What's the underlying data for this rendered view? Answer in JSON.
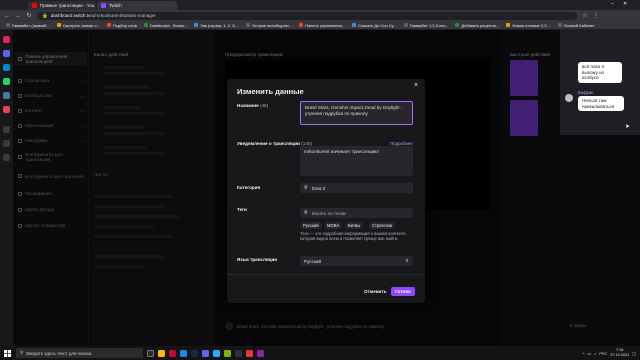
{
  "browser": {
    "tabs": [
      {
        "title": "Прямые трансляции - You",
        "color": "#ff0000",
        "active": false
      },
      {
        "title": "Twitch",
        "color": "#9147ff",
        "active": true
      }
    ],
    "url_domain": "dashboard.twitch.tv",
    "url_path": "/u/mrkonkurent/stream-manager",
    "bookmarks": [
      {
        "label": "Гаммабит (гаммаб...",
        "color": "#5f6368"
      },
      {
        "label": "Смотреть аниме о...",
        "color": "#f29900"
      },
      {
        "label": "Подбор слов",
        "color": "#ea4335"
      },
      {
        "label": "Dashboard - Books...",
        "color": "#1e8e3e"
      },
      {
        "label": "Зак (охраш, 1, 2, 3,...",
        "color": "#4285f4"
      },
      {
        "label": "Острые всеобщрны...",
        "color": "#5f6368"
      },
      {
        "label": "Панель управления...",
        "color": "#ea4335"
      },
      {
        "label": "Скачать До Сон Су...",
        "color": "#4285f4"
      },
      {
        "label": "Гаммабит 1,2,3 сез...",
        "color": "#5f6368"
      },
      {
        "label": "Добавить рецептю...",
        "color": "#1e8e3e"
      },
      {
        "label": "Новая готовые 2,3 ...",
        "color": "#f29900"
      },
      {
        "label": "Личный Кабинет",
        "color": "#5f6368"
      }
    ]
  },
  "sidebar": {
    "items": [
      {
        "label": "Панель управления трансляцией"
      },
      {
        "label": "Статистика"
      },
      {
        "label": "Сообщество"
      },
      {
        "label": "Контент"
      },
      {
        "label": "Монетизация"
      },
      {
        "label": "Настройки"
      },
      {
        "label": "Инструменты для трансляций"
      },
      {
        "label": "Инструменты для зрителей"
      },
      {
        "label": "Расширения"
      },
      {
        "label": "Центр автора"
      },
      {
        "label": "Центр сообщества"
      }
    ]
  },
  "column2": {
    "header": "Канал действий",
    "bottom_label": "Чат по"
  },
  "center": {
    "header": "Предпросмотр трансляции",
    "bottom_title": "Brawl Stars, Genshin Impact,Dead by Daylight - утреняя подрубка по приколу",
    "offline": "В эфире"
  },
  "right": {
    "header": "Быстрые действия",
    "chat": [
      {
        "text": "всё пока я выхожу из атобуса"
      },
      {
        "user": "Бафран",
        "text": "Нельзя там прикалываться"
      }
    ]
  },
  "modal": {
    "title": "Изменить данные",
    "close_icon": "close-icon",
    "title_label": "Название",
    "title_count": "(48)",
    "title_value": "Brawl Stars, Genshin Impact,Dead by Daylight - утреняя подрубка по приколу",
    "notif_label": "Уведомление о трансляции",
    "notif_count": "(140)",
    "notif_link": "Подробнее",
    "notif_value": "mrkonkurent начинает трансляцию!",
    "category_label": "Категория",
    "category_value": "Dota 2",
    "tags_label": "Теги",
    "tags_placeholder": "Искать по тегам",
    "tags": [
      "Русский",
      "MOBA",
      "Битвы",
      "Стратегии"
    ],
    "tags_help": "Теги — это подробная информация о вашем контенте, которая видна всем и позволяет проще вас найти.",
    "lang_label": "Язык трансляции",
    "lang_value": "Русский",
    "cancel": "Отменить",
    "done": "Готово"
  },
  "taskbar": {
    "search_placeholder": "Введите здесь текст для поиска",
    "time": "7:16",
    "date": "27.10.2021",
    "lang": "РУС"
  },
  "colors": {
    "accent": "#9147ff",
    "accent_border": "#a970ff",
    "bg": "#0e0e10",
    "panel": "#18181b"
  }
}
